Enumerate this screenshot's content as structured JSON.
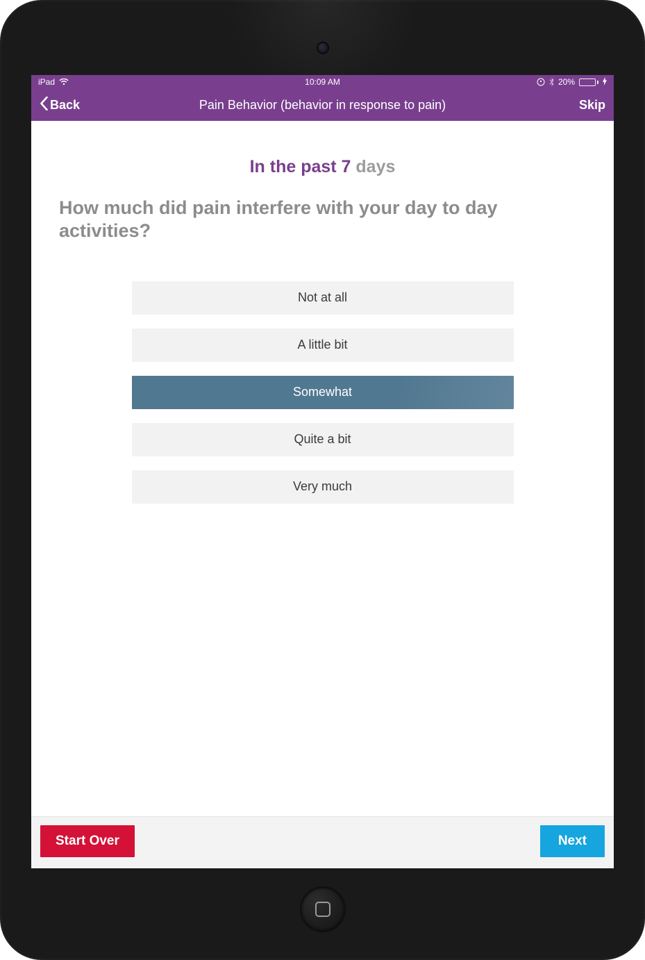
{
  "status": {
    "device": "iPad",
    "time": "10:09 AM",
    "battery_pct": "20%"
  },
  "nav": {
    "back_label": "Back",
    "title": "Pain Behavior (behavior in response to pain)",
    "skip_label": "Skip"
  },
  "content": {
    "context_prefix": "In the past 7 ",
    "context_suffix": "days",
    "question": "How much did pain interfere with your day to day activities?",
    "options": [
      {
        "label": "Not at all",
        "selected": false
      },
      {
        "label": "A little bit",
        "selected": false
      },
      {
        "label": "Somewhat",
        "selected": true
      },
      {
        "label": "Quite a bit",
        "selected": false
      },
      {
        "label": "Very much",
        "selected": false
      }
    ]
  },
  "footer": {
    "start_over": "Start Over",
    "next": "Next"
  },
  "colors": {
    "brand_purple": "#793f8e",
    "option_selected": "#517891",
    "danger": "#d41136",
    "primary": "#16a5df"
  }
}
